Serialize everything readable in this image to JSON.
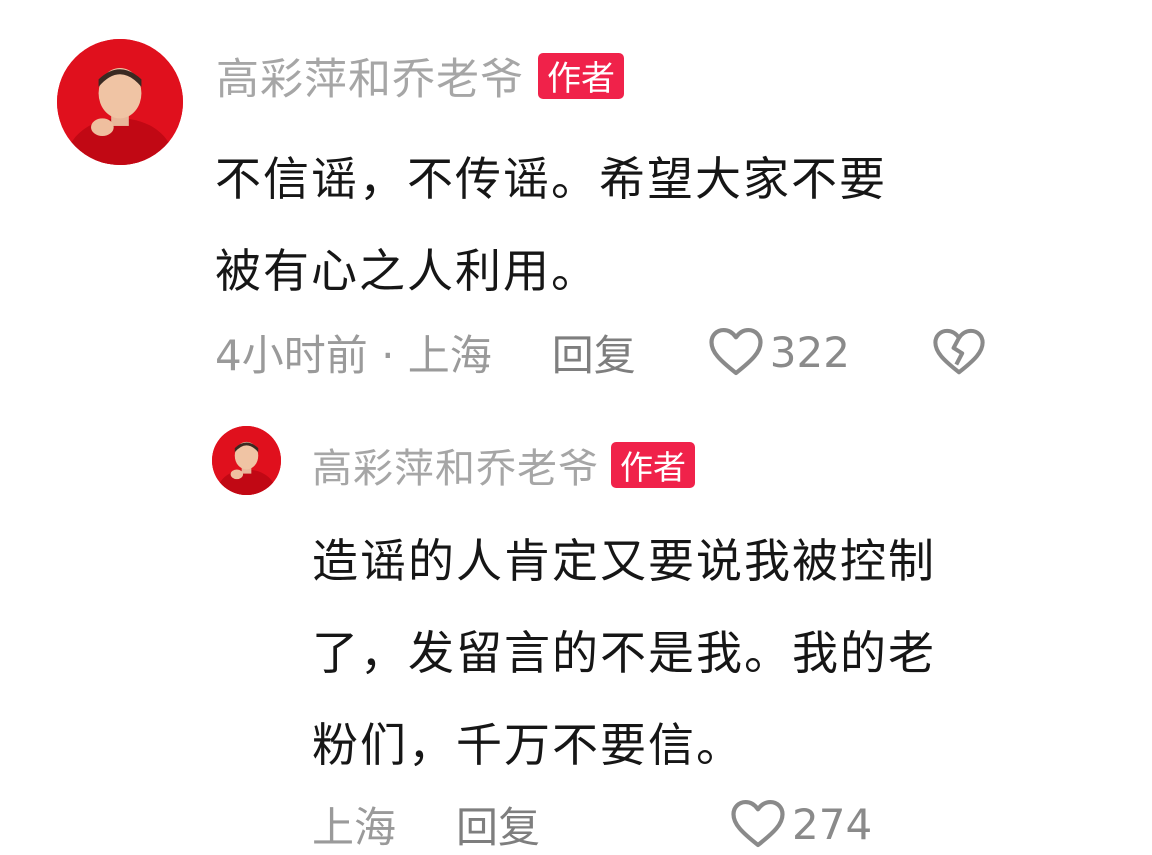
{
  "comments": [
    {
      "author": "高彩萍和乔老爷",
      "badge": "作者",
      "text": "不信谣，不传谣。希望大家不要\n被有心之人利用。",
      "time_location": "4小时前 · 上海",
      "reply_label": "回复",
      "like_count": "322",
      "like_icon": "heart-outline-icon",
      "dislike_icon": "broken-heart-icon"
    },
    {
      "author": "高彩萍和乔老爷",
      "badge": "作者",
      "text": "造谣的人肯定又要说我被控制\n了，发留言的不是我。我的老\n粉们，千万不要信。",
      "time_location": "上海",
      "reply_label": "回复",
      "like_count": "274",
      "like_icon": "heart-outline-icon",
      "dislike_icon": "broken-heart-icon"
    }
  ],
  "colors": {
    "badge_bg": "#f0224a",
    "avatar_bg": "#e1101e",
    "name": "#a6a6a6",
    "meta": "#9a9a9a"
  }
}
